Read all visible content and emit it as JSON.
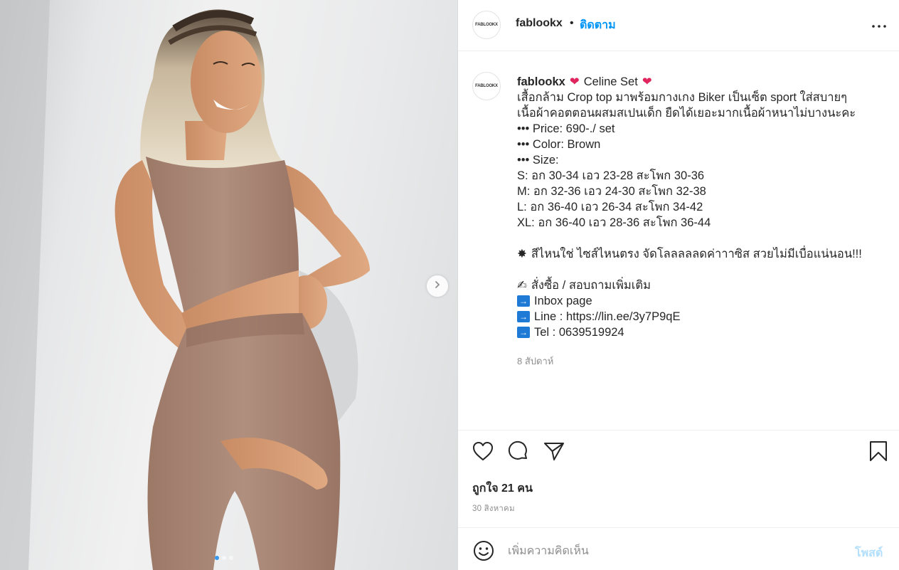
{
  "post": {
    "username": "fablookx",
    "avatar_text": "FABLOOKX",
    "follow_label": "ติดตาม",
    "separator": "•",
    "caption": {
      "title": "Celine Set",
      "lines": [
        "เสื้อกล้าม Crop top มาพร้อมกางเกง Biker เป็นเซ็ต sport ใส่สบายๆ",
        "เนื้อผ้าคอตตอนผสมสเปนเด็ก ยืดได้เยอะมากเนื้อผ้าหนาไม่บางนะคะ",
        "••• Price: 690-./ set",
        "••• Color: Brown",
        "••• Size:",
        "S: อก 30-34 เอว 23-28 สะโพก 30-36",
        "M: อก 32-36 เอว 24-30 สะโพก 32-38",
        "L: อก 36-40 เอว 26-34 สะโพก 34-42",
        "XL: อก 36-40 เอว 28-36 สะโพก 36-44"
      ],
      "highlight": "สีไหนใช่ ไซส์ไหนตรง จัดโลลลลลดค่าาาซิส สวยไม่มีเบื่อแน่นอน!!!",
      "order_label": "สั่งซื้อ / สอบถามเพิ่มเติม",
      "contacts": [
        "Inbox page",
        "Line : https://lin.ee/3y7P9qE",
        "Tel : 0639519924"
      ],
      "time_ago": "8 สัปดาห์"
    },
    "likes_text": "ถูกใจ 21 คน",
    "date_text": "30 สิงหาคม"
  },
  "comment": {
    "placeholder": "เพิ่มความคิดเห็น",
    "post_label": "โพสต์"
  },
  "carousel": {
    "current": 1,
    "total": 3
  },
  "icons": {
    "more": "more-options-icon",
    "like": "heart-icon",
    "comment": "comment-icon",
    "share": "share-icon",
    "save": "bookmark-icon",
    "emoji": "smile-icon",
    "next": "chevron-right-icon"
  },
  "colors": {
    "accent": "#0095f6",
    "post_disabled": "#b2dffc",
    "muted": "#8e8e8e",
    "text": "#262626",
    "outfit": "#a98472"
  }
}
